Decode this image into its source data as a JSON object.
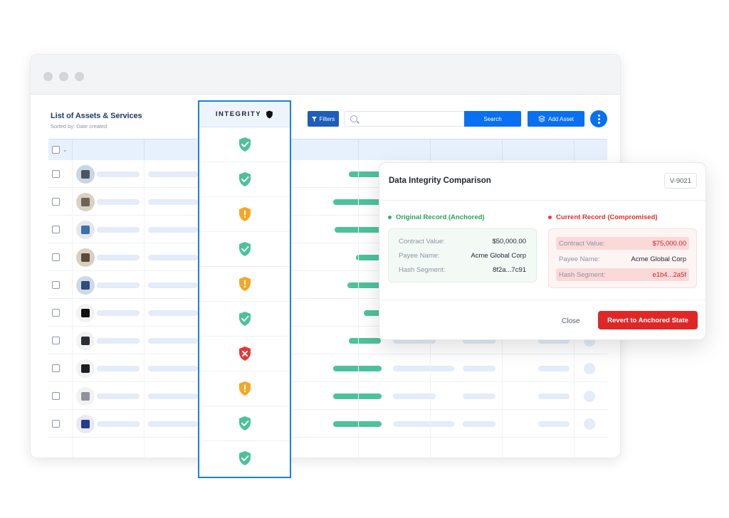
{
  "header": {
    "title": "List of Assets & Services",
    "subtitle": "Sorted by: Date created"
  },
  "toolbar": {
    "filters_label": "Filters",
    "search_placeholder": "",
    "search_label": "Search",
    "add_label": "Add Asset"
  },
  "integrity": {
    "column_label": "INTEGRITY",
    "statuses": [
      "verified",
      "verified",
      "warning",
      "verified",
      "warning",
      "verified",
      "failed",
      "warning",
      "verified",
      "verified"
    ]
  },
  "colors": {
    "accent": "#0a6ff0",
    "verified": "#4cc29a",
    "warning": "#f5a623",
    "failed": "#e53935",
    "highlight_border": "#1a7fe6"
  },
  "modal": {
    "title": "Data Integrity Comparison",
    "record_id": "V-9021",
    "original": {
      "heading": "Original Record (Anchored)",
      "rows": [
        {
          "key": "Contract Value:",
          "value": "$50,000.00"
        },
        {
          "key": "Payee Name:",
          "value": "Acme Global Corp"
        },
        {
          "key": "Hash Segment:",
          "value": "8f2a...7c91"
        }
      ]
    },
    "current": {
      "heading": "Current Record (Compromised)",
      "rows": [
        {
          "key": "Contract Value:",
          "value": "$75,000.00"
        },
        {
          "key": "Payee Name:",
          "value": "Acme Global Corp"
        },
        {
          "key": "Hash Segment:",
          "value": "e1b4...2a5f"
        }
      ]
    },
    "close_label": "Close",
    "revert_label": "Revert to Anchored State"
  }
}
